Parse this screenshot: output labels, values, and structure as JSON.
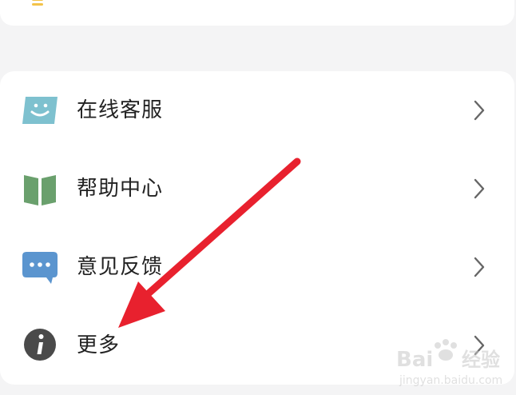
{
  "menu": {
    "items": [
      {
        "label": "在线客服",
        "icon": "customer-service-smile-icon"
      },
      {
        "label": "帮助中心",
        "icon": "help-book-icon"
      },
      {
        "label": "意见反馈",
        "icon": "feedback-chat-bubble-icon"
      },
      {
        "label": "更多",
        "icon": "info-icon"
      }
    ]
  },
  "colors": {
    "accent_red": "#e8212e",
    "service_icon": "#7ec1cf",
    "book_icon": "#6aa06d",
    "feedback_icon": "#5b95cf",
    "info_icon": "#4a4a4a",
    "top_icon": "#f3c34a"
  },
  "watermark": {
    "brand": "Bai",
    "brand_suffix": "经验",
    "url": "jingyan.baidu.com"
  }
}
